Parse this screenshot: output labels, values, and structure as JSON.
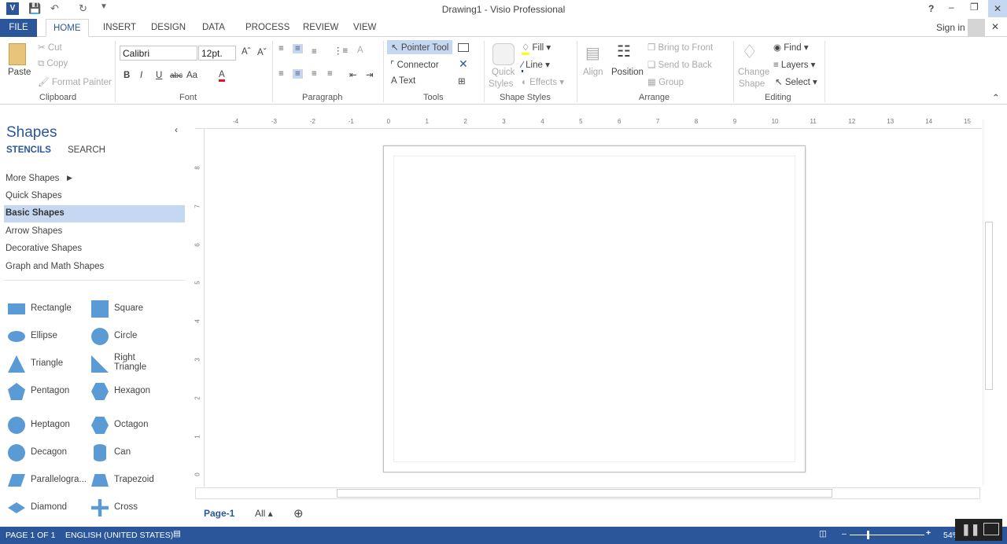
{
  "window": {
    "title": "Drawing1 - Visio Professional",
    "help": "?",
    "sign_in": "Sign in"
  },
  "tabs": [
    "FILE",
    "HOME",
    "INSERT",
    "DESIGN",
    "DATA",
    "PROCESS",
    "REVIEW",
    "VIEW"
  ],
  "ribbon": {
    "clipboard": {
      "paste": "Paste",
      "cut": "Cut",
      "copy": "Copy",
      "format_painter": "Format Painter",
      "label": "Clipboard"
    },
    "font": {
      "family": "Calibri",
      "size": "12pt.",
      "label": "Font",
      "bold": "B",
      "italic": "I",
      "underline": "U",
      "strike": "abc",
      "case": "Aa",
      "color": "A",
      "font_color": "#e81123"
    },
    "paragraph": {
      "label": "Paragraph"
    },
    "tools": {
      "pointer": "Pointer Tool",
      "connector": "Connector",
      "text": "Text",
      "label": "Tools"
    },
    "shape_styles": {
      "quick_styles": "Quick",
      "quick_styles2": "Styles",
      "fill": "Fill",
      "line": "Line",
      "effects": "Effects",
      "label": "Shape Styles"
    },
    "arrange": {
      "align": "Align",
      "position": "Position",
      "bring_front": "Bring to Front",
      "send_back": "Send to Back",
      "group": "Group",
      "label": "Arrange"
    },
    "editing": {
      "change_shape": "Change",
      "change_shape2": "Shape",
      "find": "Find",
      "layers": "Layers",
      "select": "Select",
      "label": "Editing"
    }
  },
  "shapes_pane": {
    "title": "Shapes",
    "stencils": "STENCILS",
    "search": "SEARCH",
    "stencil_list": [
      "More Shapes",
      "Quick Shapes",
      "Basic Shapes",
      "Arrow Shapes",
      "Decorative Shapes",
      "Graph and Math Shapes"
    ],
    "selected": "Basic Shapes",
    "items": [
      [
        "Rectangle",
        "Square"
      ],
      [
        "Ellipse",
        "Circle"
      ],
      [
        "Triangle",
        "Right Triangle"
      ],
      [
        "Pentagon",
        "Hexagon"
      ],
      [
        "Heptagon",
        "Octagon"
      ],
      [
        "Decagon",
        "Can"
      ],
      [
        "Parallelogra...",
        "Trapezoid"
      ],
      [
        "Diamond",
        "Cross"
      ]
    ],
    "shape_color": "#5b9bd5"
  },
  "ruler": {
    "h": [
      "-4",
      "-3",
      "-2",
      "-1",
      "0",
      "1",
      "2",
      "3",
      "4",
      "5",
      "6",
      "7",
      "8",
      "9",
      "10",
      "11",
      "12",
      "13",
      "14",
      "15"
    ],
    "v": [
      "8",
      "7",
      "6",
      "5",
      "4",
      "3",
      "2",
      "1",
      "0"
    ]
  },
  "page_tabs": {
    "page": "Page-1",
    "all": "All"
  },
  "status": {
    "page": "PAGE 1 OF 1",
    "language": "ENGLISH (UNITED STATES)",
    "zoom": "54%"
  }
}
